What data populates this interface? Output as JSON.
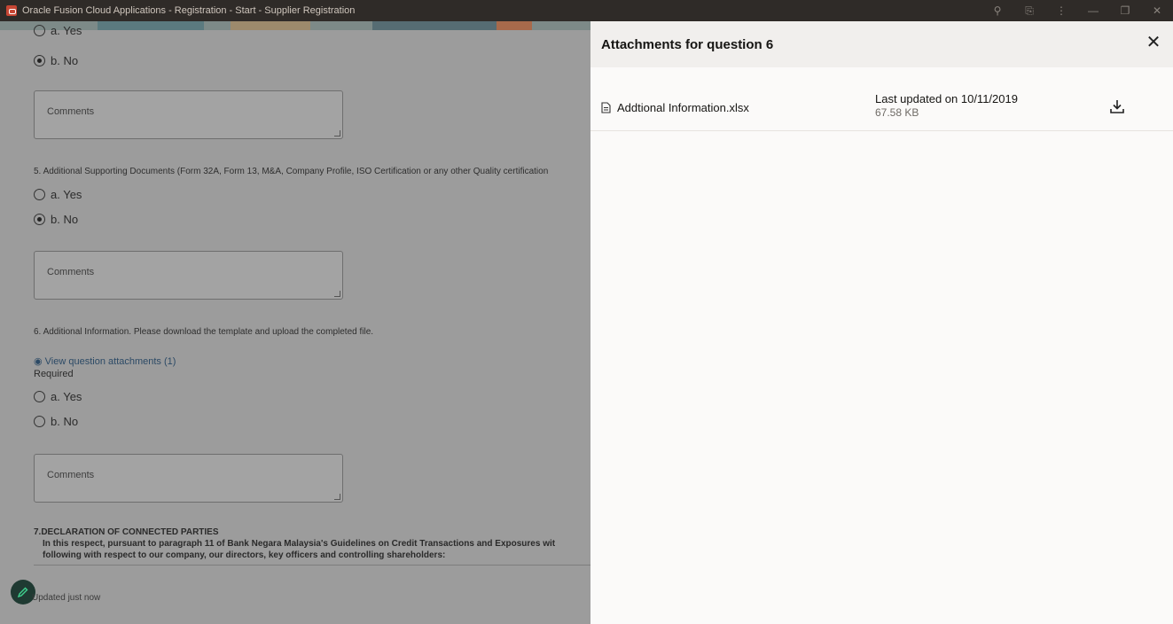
{
  "window": {
    "title": "Oracle Fusion Cloud Applications - Registration - Start - Supplier Registration"
  },
  "form": {
    "q4_options": [
      {
        "label": "a. Yes",
        "checked": false
      },
      {
        "label": "b. No",
        "checked": true
      }
    ],
    "comments_placeholder": "Comments",
    "q5": {
      "text": "5. Additional Supporting Documents (Form 32A, Form 13,  M&A, Company Profile,  ISO Certification or any other Quality certification",
      "options": [
        {
          "label": "a. Yes",
          "checked": false
        },
        {
          "label": "b. No",
          "checked": true
        }
      ]
    },
    "q6": {
      "text": "6. Additional Information. Please download the template and upload the completed file.",
      "attachments_link": "View question attachments (1)",
      "required_label": "Required",
      "options": [
        {
          "label": "a. Yes",
          "checked": false
        },
        {
          "label": "b. No",
          "checked": false
        }
      ]
    },
    "q7": {
      "title": "7.DECLARATION OF CONNECTED PARTIES",
      "line1": "In this respect, pursuant to paragraph 11 of Bank Negara Malaysia's Guidelines on Credit Transactions and Exposures wit",
      "line2": "following with respect to our company, our directors, key officers and controlling shareholders:"
    },
    "status": "Updated just now"
  },
  "drawer": {
    "title": "Attachments for question 6",
    "attachments": [
      {
        "file_name": "Addtional Information.xlsx",
        "last_updated": "Last updated on 10/11/2019",
        "size": "67.58 KB"
      }
    ]
  },
  "icons": {
    "app": "oracle-app-icon",
    "search": "search-icon",
    "extensions": "extension-icon",
    "more": "more-vertical-icon",
    "minimize": "minimize-icon",
    "restore": "restore-icon",
    "close_window": "close-window-icon",
    "close_drawer": "close-icon",
    "file": "file-icon",
    "download": "download-icon",
    "edit": "pencil-icon"
  }
}
